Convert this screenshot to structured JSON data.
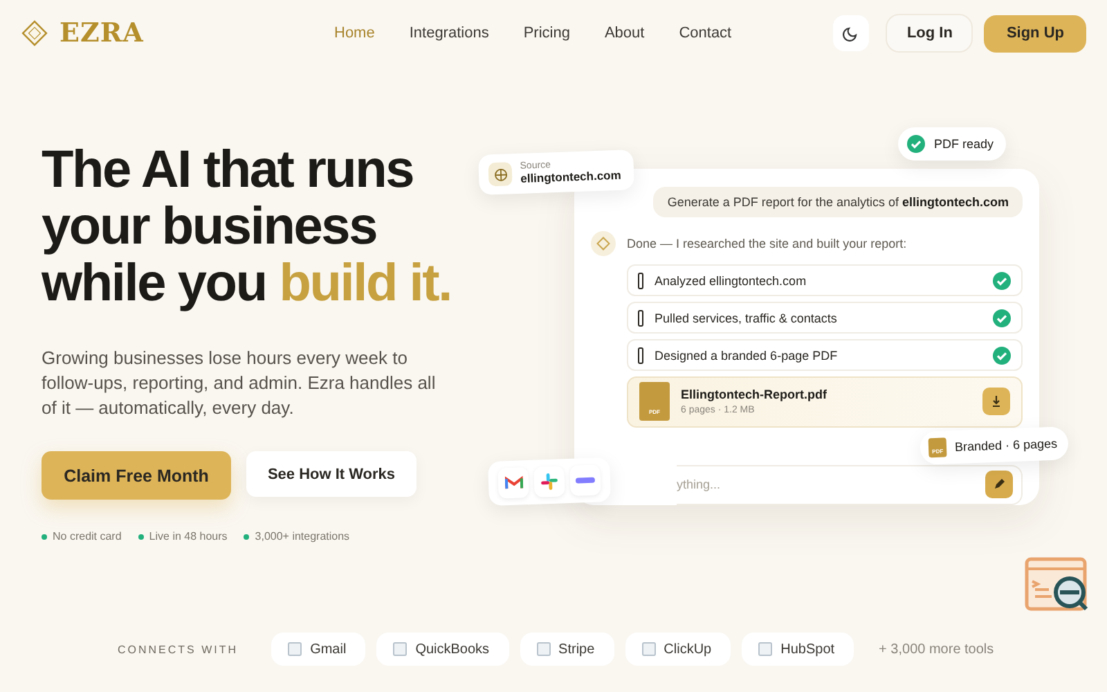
{
  "brand": {
    "name": "EZRA"
  },
  "nav": {
    "items": [
      {
        "label": "Home",
        "selected": true
      },
      {
        "label": "Integrations",
        "selected": false
      },
      {
        "label": "Pricing",
        "selected": false
      },
      {
        "label": "About",
        "selected": false
      },
      {
        "label": "Contact",
        "selected": false
      }
    ],
    "login": "Log In",
    "signup": "Sign Up"
  },
  "hero": {
    "headline_lines": [
      "The AI that runs",
      "your business"
    ],
    "headline_last": "while you",
    "headline_accent": "build it.",
    "description": "Growing businesses lose hours every week to follow-ups, reporting, and admin. Ezra handles all of it — automatically, every day.",
    "primary_button": "Claim Free Month",
    "secondary_button": "See How It Works",
    "perks": [
      "No credit card",
      "Live in 48 hours",
      "3,000+ integrations"
    ]
  },
  "chat": {
    "source_label": "Source",
    "source_value": "ellingtontech.com",
    "ready_badge": "PDF ready",
    "prompt": "Generate a PDF report for the analytics of **ellingtontech.com**",
    "reply": "Done — I researched the site and built your report:",
    "steps": [
      {
        "label": "Analyzed ellingtontech.com",
        "checked": true
      },
      {
        "label": "Pulled services, traffic & contacts",
        "checked": true
      },
      {
        "label": "Designed a branded 6-page PDF",
        "checked": true
      }
    ],
    "file": {
      "name": "Ellingtontech-Report.pdf",
      "meta": "6 pages · 1.2 MB",
      "icon_label": "PDF"
    },
    "input_placeholder": "ything...",
    "branded_badge": "Branded · 6 pages",
    "branded_icon_label": "PDF"
  },
  "connects": {
    "label": "CONNECTS WITH",
    "tools": [
      "Gmail",
      "QuickBooks",
      "Stripe",
      "ClickUp",
      "HubSpot"
    ],
    "more": "+ 3,000 more tools"
  }
}
